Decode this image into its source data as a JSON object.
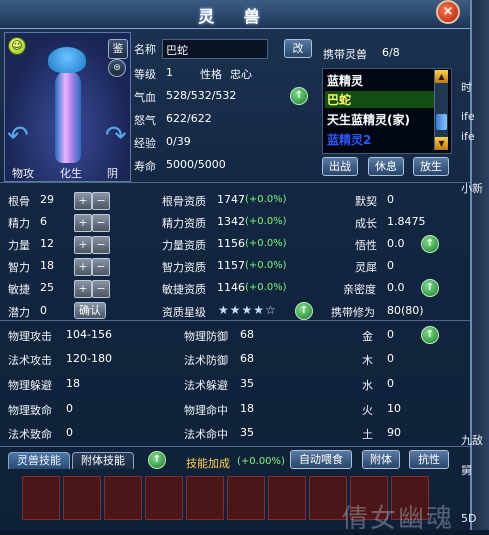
{
  "window": {
    "title": "灵 兽",
    "close": "×"
  },
  "side_tabs": [
    "时",
    "ife",
    "ife",
    "小新",
    "九敌",
    "舅",
    "5D"
  ],
  "pet_panel": {
    "buttons": {
      "attack": "物攻",
      "transform": "化生",
      "yin": "阴",
      "appraise": "鉴"
    }
  },
  "info": {
    "name_label": "名称",
    "name": "巴蛇",
    "rename_button": "改",
    "level_label": "等级",
    "level": "1",
    "nature_label": "性格",
    "nature": "忠心",
    "hp_label": "气血",
    "hp": "528/532/532",
    "rage_label": "怒气",
    "rage": "622/622",
    "exp_label": "经验",
    "exp": "0/39",
    "life_label": "寿命",
    "life": "5000/5000"
  },
  "carry": {
    "label": "携带灵兽",
    "count": "6/8",
    "items": [
      "蓝精灵",
      "巴蛇",
      "天生蓝精灵(家)",
      "蓝精灵2"
    ],
    "buttons": {
      "battle": "出战",
      "rest": "休息",
      "release": "放生"
    }
  },
  "base_stats": [
    {
      "label": "根骨",
      "value": "29"
    },
    {
      "label": "精力",
      "value": "6"
    },
    {
      "label": "力量",
      "value": "12"
    },
    {
      "label": "智力",
      "value": "18"
    },
    {
      "label": "敏捷",
      "value": "25"
    }
  ],
  "potential": {
    "label": "潜力",
    "value": "0",
    "confirm": "确认"
  },
  "aptitudes": [
    {
      "label": "根骨资质",
      "value": "1747",
      "bonus": "(+0.0%)"
    },
    {
      "label": "精力资质",
      "value": "1342",
      "bonus": "(+0.0%)"
    },
    {
      "label": "力量资质",
      "value": "1156",
      "bonus": "(+0.0%)"
    },
    {
      "label": "智力资质",
      "value": "1157",
      "bonus": "(+0.0%)"
    },
    {
      "label": "敏捷资质",
      "value": "1146",
      "bonus": "(+0.0%)"
    }
  ],
  "aptitude_star": {
    "label": "资质星级",
    "stars": "★★★★☆",
    "rating": 4,
    "max": 5
  },
  "right_stats": [
    {
      "label": "默契",
      "value": "0"
    },
    {
      "label": "成长",
      "value": "1.8475"
    },
    {
      "label": "悟性",
      "value": "0.0"
    },
    {
      "label": "灵犀",
      "value": "0"
    },
    {
      "label": "亲密度",
      "value": "0.0"
    }
  ],
  "cultivation": {
    "label": "携带修为",
    "value": "80(80)"
  },
  "combat": {
    "left": [
      {
        "label": "物理攻击",
        "value": "104-156"
      },
      {
        "label": "法术攻击",
        "value": "120-180"
      },
      {
        "label": "物理躲避",
        "value": "18"
      },
      {
        "label": "物理致命",
        "value": "0"
      },
      {
        "label": "法术致命",
        "value": "0"
      }
    ],
    "mid": [
      {
        "label": "物理防御",
        "value": "68"
      },
      {
        "label": "法术防御",
        "value": "68"
      },
      {
        "label": "法术躲避",
        "value": "35"
      },
      {
        "label": "物理命中",
        "value": "18"
      },
      {
        "label": "法术命中",
        "value": "35"
      }
    ],
    "elements": [
      {
        "label": "金",
        "value": "0"
      },
      {
        "label": "木",
        "value": "0"
      },
      {
        "label": "水",
        "value": "0"
      },
      {
        "label": "火",
        "value": "10"
      },
      {
        "label": "土",
        "value": "90"
      }
    ]
  },
  "bottom": {
    "tab_skills": "灵兽技能",
    "tab_attach": "附体技能",
    "skill_bonus_label": "技能加成",
    "skill_bonus": "(+0.00%)",
    "auto_feed": "自动喂食",
    "attach": "附体",
    "resist": "抗性"
  },
  "watermark": "倩女幽魂",
  "colors": {
    "bonus_green": "#7cf87c",
    "selected_bg": "#114f14",
    "slot_red": "#4a1618"
  }
}
